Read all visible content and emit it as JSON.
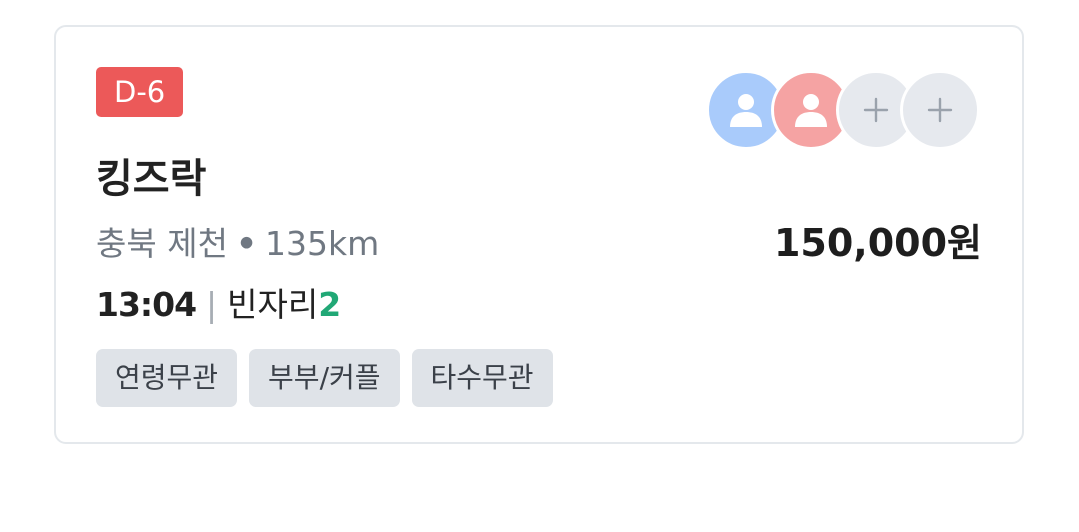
{
  "card": {
    "dday_badge": "D-6",
    "title": "킹즈락",
    "location": "충북 제천",
    "separator_dot": "•",
    "distance": "135km",
    "price": "150,000원",
    "time": "13:04",
    "divider": "|",
    "seats_label": "빈자리",
    "seats_count": "2",
    "tags": [
      "연령무관",
      "부부/커플",
      "타수무관"
    ],
    "participants": [
      {
        "type": "member",
        "icon": "person-icon",
        "color": "#a9cbfb"
      },
      {
        "type": "member",
        "icon": "person-icon",
        "color": "#f5a3a3"
      },
      {
        "type": "empty",
        "icon": "plus-icon",
        "color": "#e6e9ee"
      },
      {
        "type": "empty",
        "icon": "plus-icon",
        "color": "#e6e9ee"
      }
    ]
  },
  "colors": {
    "badge": "#ec5959",
    "accent_green": "#21a876",
    "tag_bg": "#dfe3e8",
    "muted_text": "#707882"
  }
}
